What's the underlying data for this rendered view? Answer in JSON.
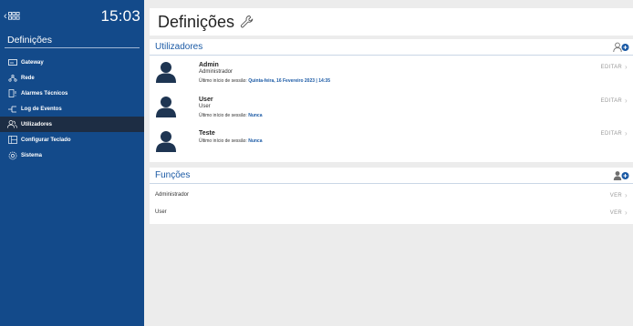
{
  "sidebar": {
    "back_label": "<",
    "time": "15:03",
    "title": "Definições",
    "items": [
      {
        "label": "Gateway",
        "icon": "gateway-icon"
      },
      {
        "label": "Rede",
        "icon": "network-icon"
      },
      {
        "label": "Alarmes Técnicos",
        "icon": "technical-alarm-icon"
      },
      {
        "label": "Log de Eventos",
        "icon": "event-log-icon"
      },
      {
        "label": "Utilizadores",
        "icon": "users-icon"
      },
      {
        "label": "Configurar Teclado",
        "icon": "keyboard-icon"
      },
      {
        "label": "Sistema",
        "icon": "system-gear-icon"
      }
    ],
    "active_index": 4
  },
  "page": {
    "title": "Definições"
  },
  "users_panel": {
    "title": "Utilizadores",
    "edit_label": "EDITAR",
    "last_login_label": "Último início de sessão:",
    "users": [
      {
        "name": "Admin",
        "role": "Administrador",
        "last_login": "Quinta-feira, 16 Fevereiro 2023 | 14:35"
      },
      {
        "name": "User",
        "role": "User",
        "last_login": "Nunca"
      },
      {
        "name": "Teste",
        "role": "",
        "last_login": "Nunca"
      }
    ]
  },
  "functions_panel": {
    "title": "Funções",
    "view_label": "VER",
    "items": [
      {
        "label": "Administrador"
      },
      {
        "label": "User"
      }
    ]
  },
  "colors": {
    "sidebar_bg": "#134a8a",
    "active_item_bg": "#1d2d44",
    "accent": "#1b5aa5"
  }
}
